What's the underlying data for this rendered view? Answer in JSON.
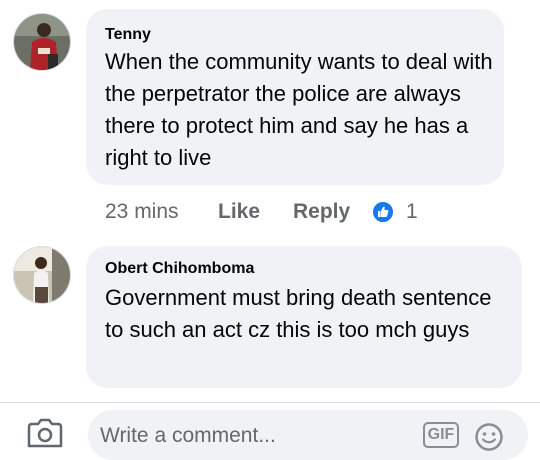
{
  "comments": [
    {
      "author": "Tenny",
      "text": "When the community wants to deal with the perpetrator the police are always there to protect him and say he has a right to live",
      "time": "23 mins",
      "like_label": "Like",
      "reply_label": "Reply",
      "reaction_count": "1"
    },
    {
      "author": "Obert Chihomboma",
      "text": "Government must bring death sentence to such an act cz this is too mch guys"
    }
  ],
  "composer": {
    "placeholder": "Write a comment...",
    "gif_label": "GIF"
  },
  "colors": {
    "bubble": "#f0f2f5",
    "meta_text": "#65676b",
    "like_blue": "#1877f2"
  }
}
